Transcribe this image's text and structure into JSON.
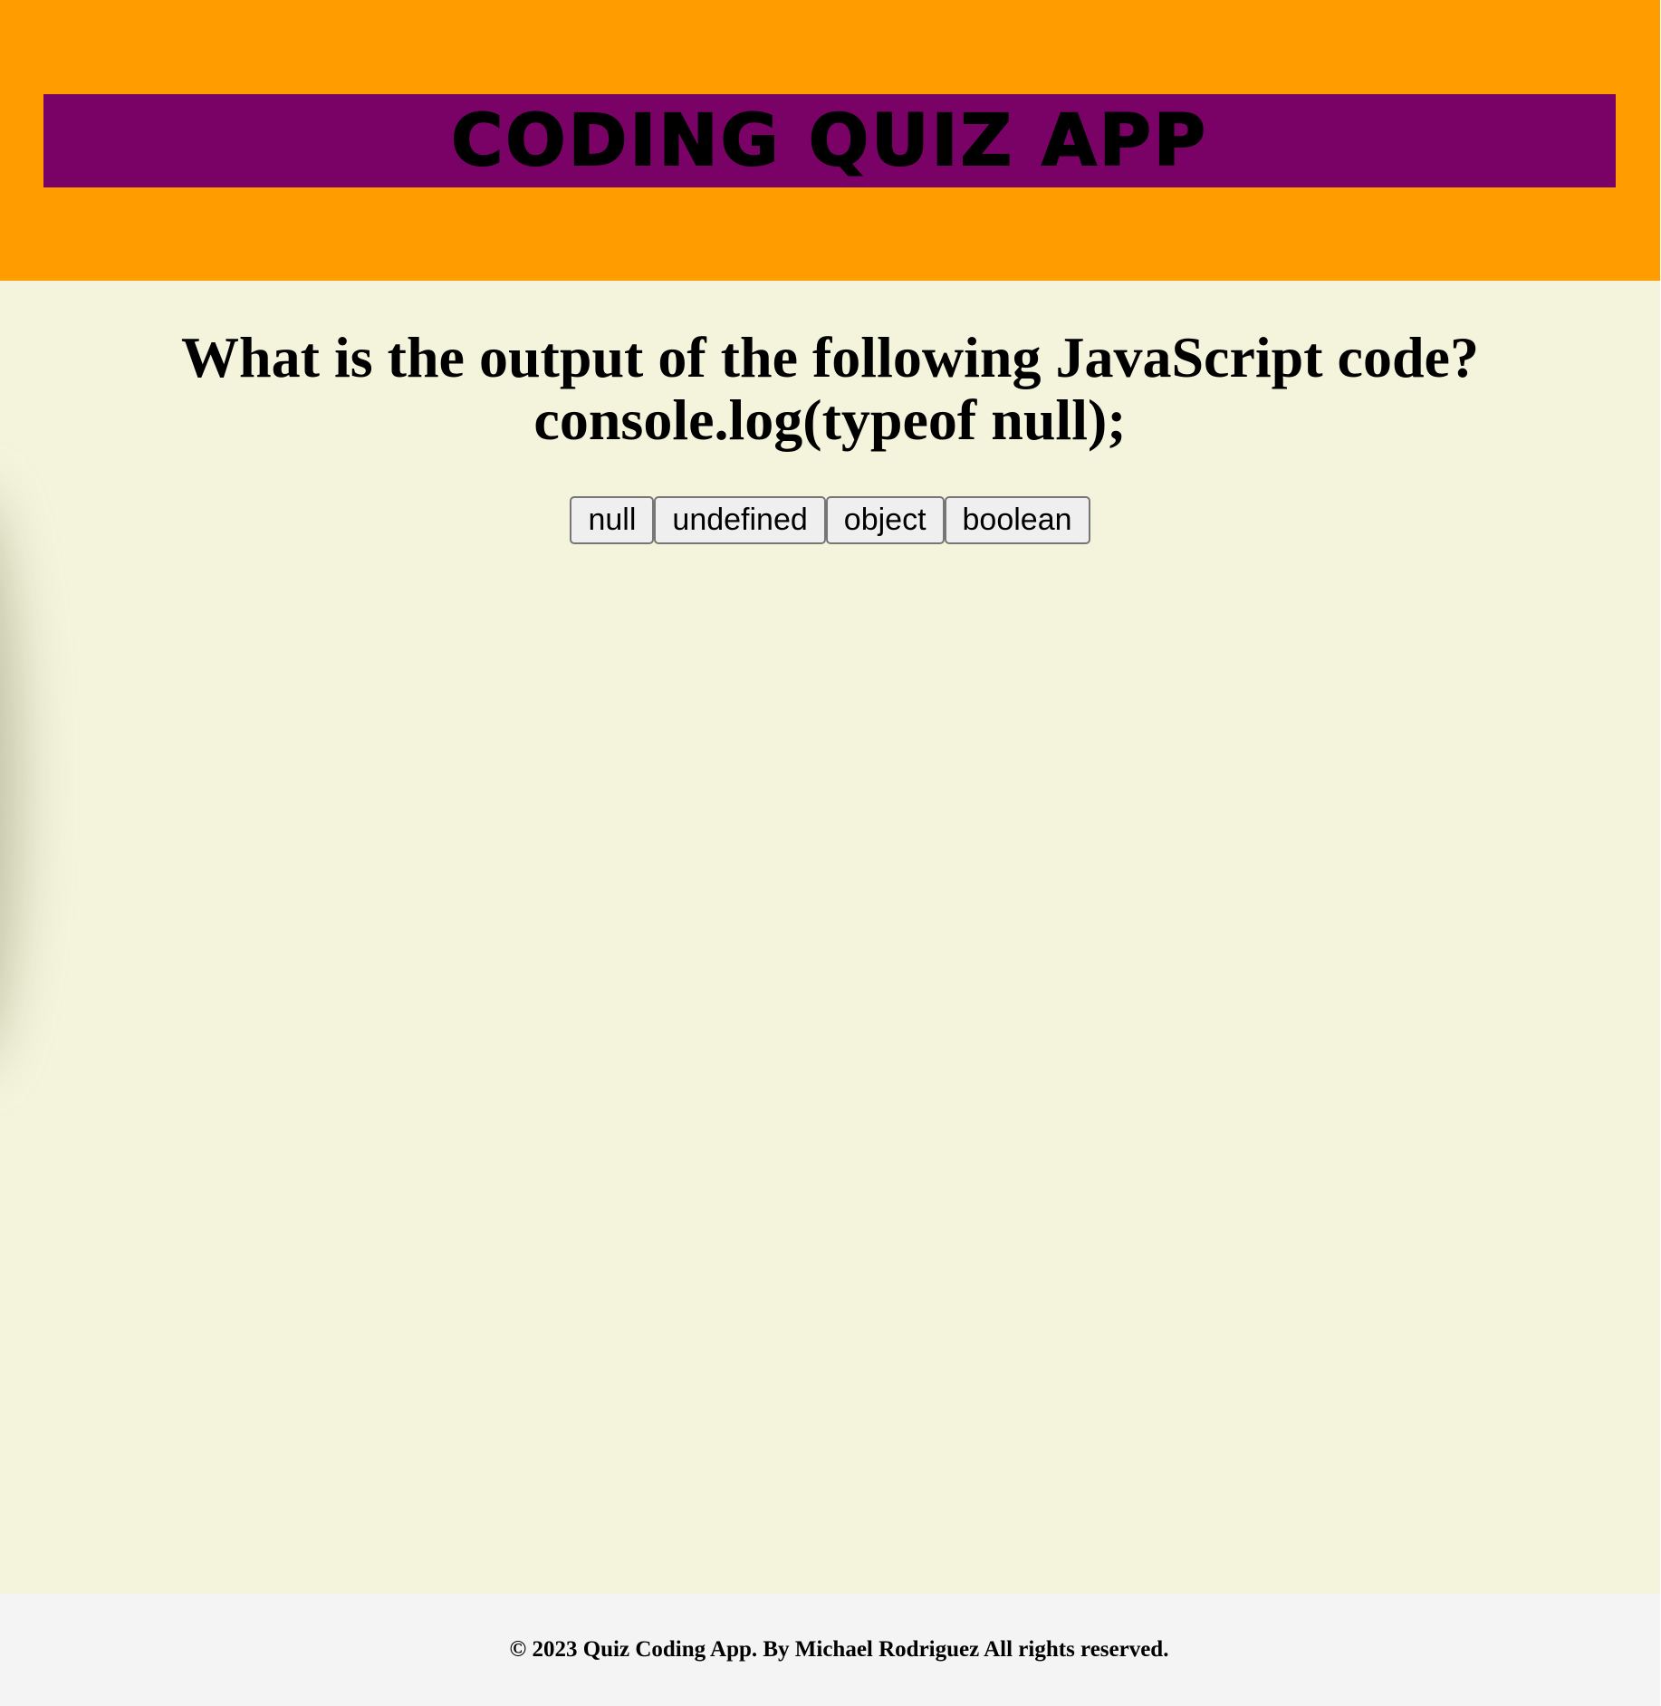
{
  "header": {
    "title": "CODING QUIZ APP"
  },
  "quiz": {
    "question": "What is the output of the following JavaScript code? console.log(typeof null);",
    "answers": [
      "null",
      "undefined",
      "object",
      "boolean"
    ]
  },
  "footer": {
    "copyright": "© 2023 Quiz Coding App. By Michael Rodriguez All rights reserved."
  },
  "colors": {
    "header_bg": "#ff9d00",
    "banner_bg": "#7a0267",
    "main_bg": "#f4f4dc",
    "footer_bg": "#f4f4f4"
  }
}
